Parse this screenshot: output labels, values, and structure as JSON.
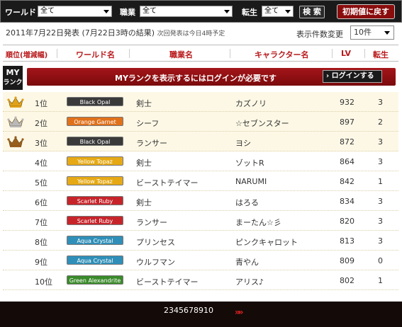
{
  "filters": {
    "world_label": "ワールド",
    "world_value": "全て",
    "job_label": "職業",
    "job_value": "全て",
    "rebirth_label": "転生",
    "rebirth_value": "全て",
    "search_label": "検 索",
    "reset_label": "初期値に戻す"
  },
  "info": {
    "announce": "2011年7月22日発表 (7月22日3時の結果)",
    "next": "次回発表は今日4時予定",
    "count_label": "表示件数変更",
    "count_value": "10件"
  },
  "columns": {
    "rank": "順位(増減幅)",
    "world": "ワールド名",
    "job": "職業名",
    "character": "キャラクター名",
    "lv": "LV",
    "rebirth": "転生"
  },
  "myrank": {
    "box_my": "MY",
    "box_rank": "ランク",
    "message": "MYランクを表示するにはログインが必要です",
    "login_label": "ログインする"
  },
  "rows": [
    {
      "rank": "1位",
      "world": "Black Opal",
      "job": "剣士",
      "name": "カズノリ",
      "lv": "932",
      "rebirth": "3"
    },
    {
      "rank": "2位",
      "world": "Orange Garnet",
      "job": "シーフ",
      "name": "☆セブンスター",
      "lv": "897",
      "rebirth": "2"
    },
    {
      "rank": "3位",
      "world": "Black Opal",
      "job": "ランサー",
      "name": "ヨシ",
      "lv": "872",
      "rebirth": "3"
    },
    {
      "rank": "4位",
      "world": "Yellow Topaz",
      "job": "剣士",
      "name": "ゾットR",
      "lv": "864",
      "rebirth": "3"
    },
    {
      "rank": "5位",
      "world": "Yellow Topaz",
      "job": "ビーストテイマー",
      "name": "NARUMI",
      "lv": "842",
      "rebirth": "1"
    },
    {
      "rank": "6位",
      "world": "Scarlet Ruby",
      "job": "剣士",
      "name": "はろる",
      "lv": "834",
      "rebirth": "3"
    },
    {
      "rank": "7位",
      "world": "Scarlet Ruby",
      "job": "ランサー",
      "name": "まーたん☆彡",
      "lv": "820",
      "rebirth": "3"
    },
    {
      "rank": "8位",
      "world": "Aqua Crystal",
      "job": "プリンセス",
      "name": "ピンクキャロット",
      "lv": "813",
      "rebirth": "3"
    },
    {
      "rank": "9位",
      "world": "Aqua Crystal",
      "job": "ウルフマン",
      "name": "青やん",
      "lv": "809",
      "rebirth": "0"
    },
    {
      "rank": "10位",
      "world": "Green Alexandrite",
      "job": "ビーストテイマー",
      "name": "アリス♪",
      "lv": "802",
      "rebirth": "1"
    }
  ],
  "world_colors": {
    "Black Opal": "#3a3a3a",
    "Orange Garnet": "#e0701a",
    "Yellow Topaz": "#e6a915",
    "Scarlet Ruby": "#c7242a",
    "Aqua Crystal": "#2f8fb8",
    "Green Alexandrite": "#3a8a2a"
  },
  "crown_colors": [
    "#e0a21a",
    "#b9b9b9",
    "#9a5e1c"
  ],
  "pagination": {
    "pages": [
      "2",
      "3",
      "4",
      "5",
      "6",
      "7",
      "8",
      "9",
      "10"
    ],
    "next_icon": "double-chevron-right-icon"
  }
}
